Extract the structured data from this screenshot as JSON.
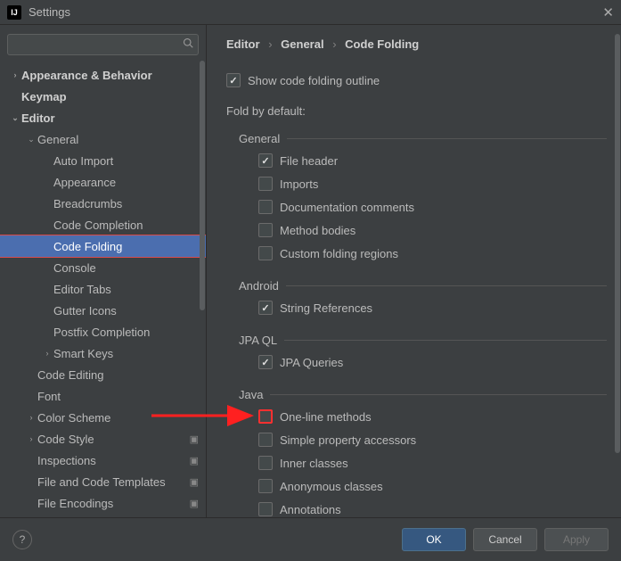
{
  "window": {
    "title": "Settings",
    "app_icon_text": "IJ"
  },
  "search": {
    "placeholder": ""
  },
  "sidebar": {
    "items": [
      {
        "label": "Appearance & Behavior",
        "level": 0,
        "chev": "›",
        "bold": true
      },
      {
        "label": "Keymap",
        "level": 0,
        "chev": "",
        "bold": true
      },
      {
        "label": "Editor",
        "level": 0,
        "chev": "⌄",
        "bold": true
      },
      {
        "label": "General",
        "level": 1,
        "chev": "⌄"
      },
      {
        "label": "Auto Import",
        "level": 2,
        "chev": ""
      },
      {
        "label": "Appearance",
        "level": 2,
        "chev": ""
      },
      {
        "label": "Breadcrumbs",
        "level": 2,
        "chev": ""
      },
      {
        "label": "Code Completion",
        "level": 2,
        "chev": ""
      },
      {
        "label": "Code Folding",
        "level": 2,
        "chev": "",
        "selected": true,
        "highlight": true
      },
      {
        "label": "Console",
        "level": 2,
        "chev": ""
      },
      {
        "label": "Editor Tabs",
        "level": 2,
        "chev": ""
      },
      {
        "label": "Gutter Icons",
        "level": 2,
        "chev": ""
      },
      {
        "label": "Postfix Completion",
        "level": 2,
        "chev": ""
      },
      {
        "label": "Smart Keys",
        "level": 2,
        "chev": "›"
      },
      {
        "label": "Code Editing",
        "level": 1,
        "chev": ""
      },
      {
        "label": "Font",
        "level": 1,
        "chev": ""
      },
      {
        "label": "Color Scheme",
        "level": 1,
        "chev": "›"
      },
      {
        "label": "Code Style",
        "level": 1,
        "chev": "›",
        "gear": true
      },
      {
        "label": "Inspections",
        "level": 1,
        "chev": "",
        "gear": true
      },
      {
        "label": "File and Code Templates",
        "level": 1,
        "chev": "",
        "gear": true
      },
      {
        "label": "File Encodings",
        "level": 1,
        "chev": "",
        "gear": true
      }
    ]
  },
  "breadcrumb": {
    "a": "Editor",
    "b": "General",
    "c": "Code Folding"
  },
  "main": {
    "show_outline": {
      "label": "Show code folding outline",
      "checked": true
    },
    "fold_by_default": "Fold by default:",
    "groups": [
      {
        "name": "General",
        "items": [
          {
            "label": "File header",
            "checked": true
          },
          {
            "label": "Imports",
            "checked": false
          },
          {
            "label": "Documentation comments",
            "checked": false
          },
          {
            "label": "Method bodies",
            "checked": false
          },
          {
            "label": "Custom folding regions",
            "checked": false
          }
        ]
      },
      {
        "name": "Android",
        "items": [
          {
            "label": "String References",
            "checked": true
          }
        ]
      },
      {
        "name": "JPA QL",
        "items": [
          {
            "label": "JPA Queries",
            "checked": true
          }
        ]
      },
      {
        "name": "Java",
        "items": [
          {
            "label": "One-line methods",
            "checked": false,
            "highlight": true
          },
          {
            "label": "Simple property accessors",
            "checked": false
          },
          {
            "label": "Inner classes",
            "checked": false
          },
          {
            "label": "Anonymous classes",
            "checked": false
          },
          {
            "label": "Annotations",
            "checked": false
          }
        ]
      }
    ]
  },
  "footer": {
    "ok": "OK",
    "cancel": "Cancel",
    "apply": "Apply"
  }
}
